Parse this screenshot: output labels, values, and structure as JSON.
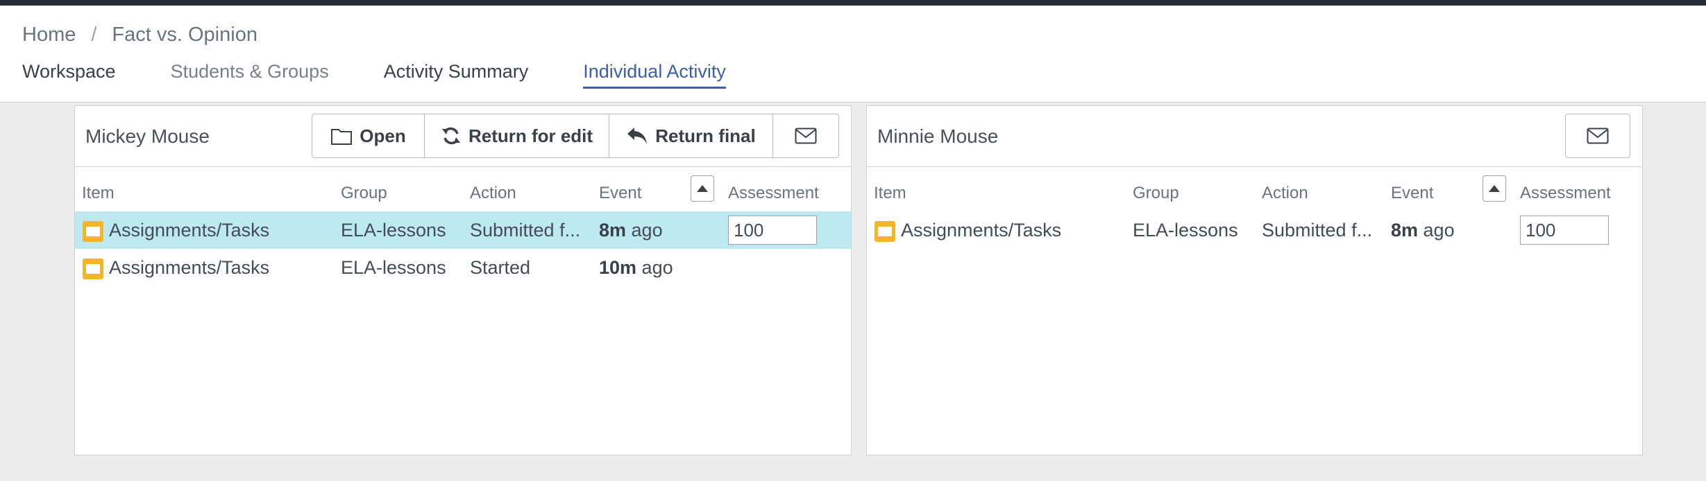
{
  "breadcrumb": {
    "home": "Home",
    "separator": "/",
    "current": "Fact vs. Opinion"
  },
  "tabs": [
    {
      "label": "Workspace"
    },
    {
      "label": "Students & Groups"
    },
    {
      "label": "Activity Summary"
    },
    {
      "label": "Individual Activity"
    }
  ],
  "colors": {
    "accent": "#3b5fa8",
    "selected_row": "#bdeaf2",
    "folder": "#f4b52a"
  },
  "columns": {
    "item": "Item",
    "group": "Group",
    "action": "Action",
    "event": "Event",
    "assessment": "Assessment"
  },
  "panels": [
    {
      "student": "Mickey Mouse",
      "buttons": {
        "open": "Open",
        "return_edit": "Return for edit",
        "return_final": "Return final"
      },
      "rows": [
        {
          "item": "Assignments/Tasks",
          "group": "ELA-lessons",
          "action": "Submitted f...",
          "event_num": "8m",
          "event_suffix": " ago",
          "assessment": "100",
          "selected": true
        },
        {
          "item": "Assignments/Tasks",
          "group": "ELA-lessons",
          "action": "Started",
          "event_num": "10m",
          "event_suffix": " ago",
          "assessment": null,
          "selected": false
        }
      ]
    },
    {
      "student": "Minnie Mouse",
      "rows": [
        {
          "item": "Assignments/Tasks",
          "group": "ELA-lessons",
          "action": "Submitted f...",
          "event_num": "8m",
          "event_suffix": " ago",
          "assessment": "100",
          "selected": false
        }
      ]
    }
  ]
}
